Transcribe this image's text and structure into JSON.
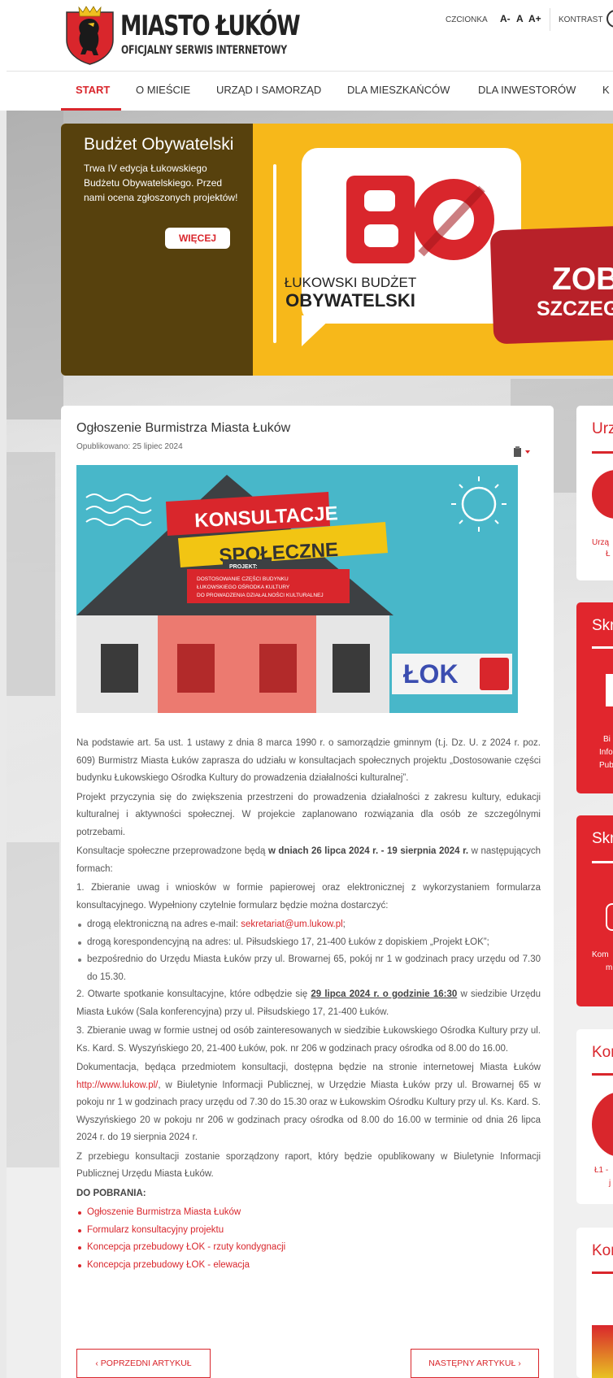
{
  "header": {
    "site_title": "MIASTO ŁUKÓW",
    "site_subtitle": "OFICJALNY SERWIS INTERNETOWY",
    "font_label": "CZCIONKA",
    "font_small": "A-",
    "font_normal": "A",
    "font_large": "A+",
    "contrast_label": "KONTRAST"
  },
  "nav": {
    "items": [
      "START",
      "O MIEŚCIE",
      "URZĄD I SAMORZĄD",
      "DLA MIESZKAŃCÓW",
      "DLA INWESTORÓW",
      "K"
    ]
  },
  "banner": {
    "title": "Budżet Obywatelski",
    "text": "Trwa IV edycja Łukowskiego Budżetu Obywatelskiego. Przed nami ocena zgłoszonych projektów!",
    "button": "WIĘCEJ",
    "logo_letters": "BO",
    "logo_line1": "ŁUKOWSKI BUDŻET",
    "logo_line2": "OBYWATELSKI",
    "cta_line1": "ZOBA",
    "cta_line2": "SZCZEG"
  },
  "article": {
    "title": "Ogłoszenie Burmistrza Miasta Łuków",
    "date": "Opublikowano: 25 lipiec 2024",
    "image": {
      "heading1": "KONSULTACJE",
      "heading2": "SPOŁECZNE",
      "project_label": "PROJEKT:",
      "project_text1": "DOSTOSOWANIE CZĘŚCI BUDYNKU",
      "project_text2": "ŁUKOWSKIEGO OŚRODKA KULTURY",
      "project_text3": "DO PROWADZENIA DZIAŁALNOŚCI KULTURALNEJ",
      "logo_text": "ŁOK"
    },
    "p1": "Na podstawie art. 5a ust. 1 ustawy z dnia 8 marca 1990 r. o samorządzie gminnym (t.j. Dz. U. z 2024 r. poz. 609) Burmistrz Miasta Łuków zaprasza do udziału w konsultacjach społecznych projektu „Dostosowanie części budynku Łukowskiego Ośrodka Kultury do prowadzenia działalności kulturalnej”.",
    "p2": "Projekt przyczynia się do zwiększenia przestrzeni do prowadzenia działalności z zakresu kultury, edukacji kulturalnej i aktywności społecznej. W projekcie zaplanowano rozwiązania dla osób ze szczególnymi potrzebami.",
    "p3_pre": "Konsultacje społeczne przeprowadzone będą ",
    "p3_bold": "w dniach 26 lipca 2024 r. - 19 sierpnia 2024 r.",
    "p3_post": " w następujących formach:",
    "p4": "1. Zbieranie uwag i wniosków w formie papierowej oraz elektronicznej z wykorzystaniem formularza konsultacyjnego. Wypełniony czytelnie formularz będzie można dostarczyć:",
    "li1_pre": "drogą elektroniczną na adres e-mail: ",
    "li1_link": "sekretariat@um.lukow.pl",
    "li1_post": ";",
    "li2": "drogą korespondencyjną na adres: ul. Piłsudskiego 17, 21-400 Łuków z dopiskiem „Projekt ŁOK”;",
    "li3": "bezpośrednio do Urzędu Miasta Łuków przy ul. Browarnej 65, pokój nr 1 w godzinach pracy urzędu od 7.30 do 15.30.",
    "p5_pre": "2. Otwarte spotkanie konsultacyjne, które odbędzie się ",
    "p5_bold": "29 lipca 2024 r. o godzinie 16:30",
    "p5_post": " w siedzibie Urzędu Miasta Łuków (Sala konferencyjna) przy ul. Piłsudskiego 17, 21-400 Łuków.",
    "p6": "3. Zbieranie uwag w formie ustnej od osób zainteresowanych w siedzibie Łukowskiego Ośrodka Kultury przy ul. Ks. Kard. S. Wyszyńskiego 20, 21-400 Łuków, pok. nr 206 w godzinach pracy ośrodka od 8.00 do 16.00.",
    "p7_pre": "Dokumentacja, będąca przedmiotem konsultacji, dostępna będzie na stronie internetowej Miasta Łuków ",
    "p7_link": "http://www.lukow.pl/",
    "p7_post": ", w Biuletynie Informacji Publicznej, w Urzędzie Miasta Łuków przy ul. Browarnej 65 w pokoju nr 1 w godzinach pracy urzędu od 7.30 do 15.30 oraz w Łukowskim Ośrodku Kultury przy ul. Ks. Kard. S. Wyszyńskiego 20 w pokoju nr 206 w godzinach pracy ośrodka od 8.00 do 16.00 w terminie od dnia 26 lipca 2024 r. do 19 sierpnia 2024 r.",
    "p8": "Z przebiegu konsultacji zostanie sporządzony raport, który będzie opublikowany w Biuletynie Informacji Publicznej Urzędu Miasta Łuków.",
    "downloads_label": "DO POBRANIA:",
    "downloads": [
      "Ogłoszenie Burmistrza Miasta Łuków",
      "Formularz konsultacyjny projektu",
      "Koncepcja przebudowy ŁOK - rzuty kondygnacji",
      "Koncepcja przebudowy ŁOK - elewacja"
    ],
    "prev_button": "‹  POPRZEDNI ARTYKUŁ",
    "next_button": "NASTĘPNY ARTYKUŁ  ›"
  },
  "sidebar": {
    "card1_title": "Urz",
    "card1_caption1": "Urzą",
    "card1_caption2": "Ł",
    "card2_title": "Skr",
    "card2_line1": "Bi",
    "card2_line2": "Info",
    "card2_line3": "Pub",
    "card3_title": "Skr",
    "card3_line1": "Kom",
    "card3_line2": "m",
    "card4_title": "Kon",
    "card4_line1": "Ł1 -",
    "card4_line2": "j",
    "card5_title": "Kon"
  },
  "colors": {
    "accent": "#d9262c",
    "banner_dark": "#57410d",
    "banner_yellow": "#f7b81a"
  }
}
